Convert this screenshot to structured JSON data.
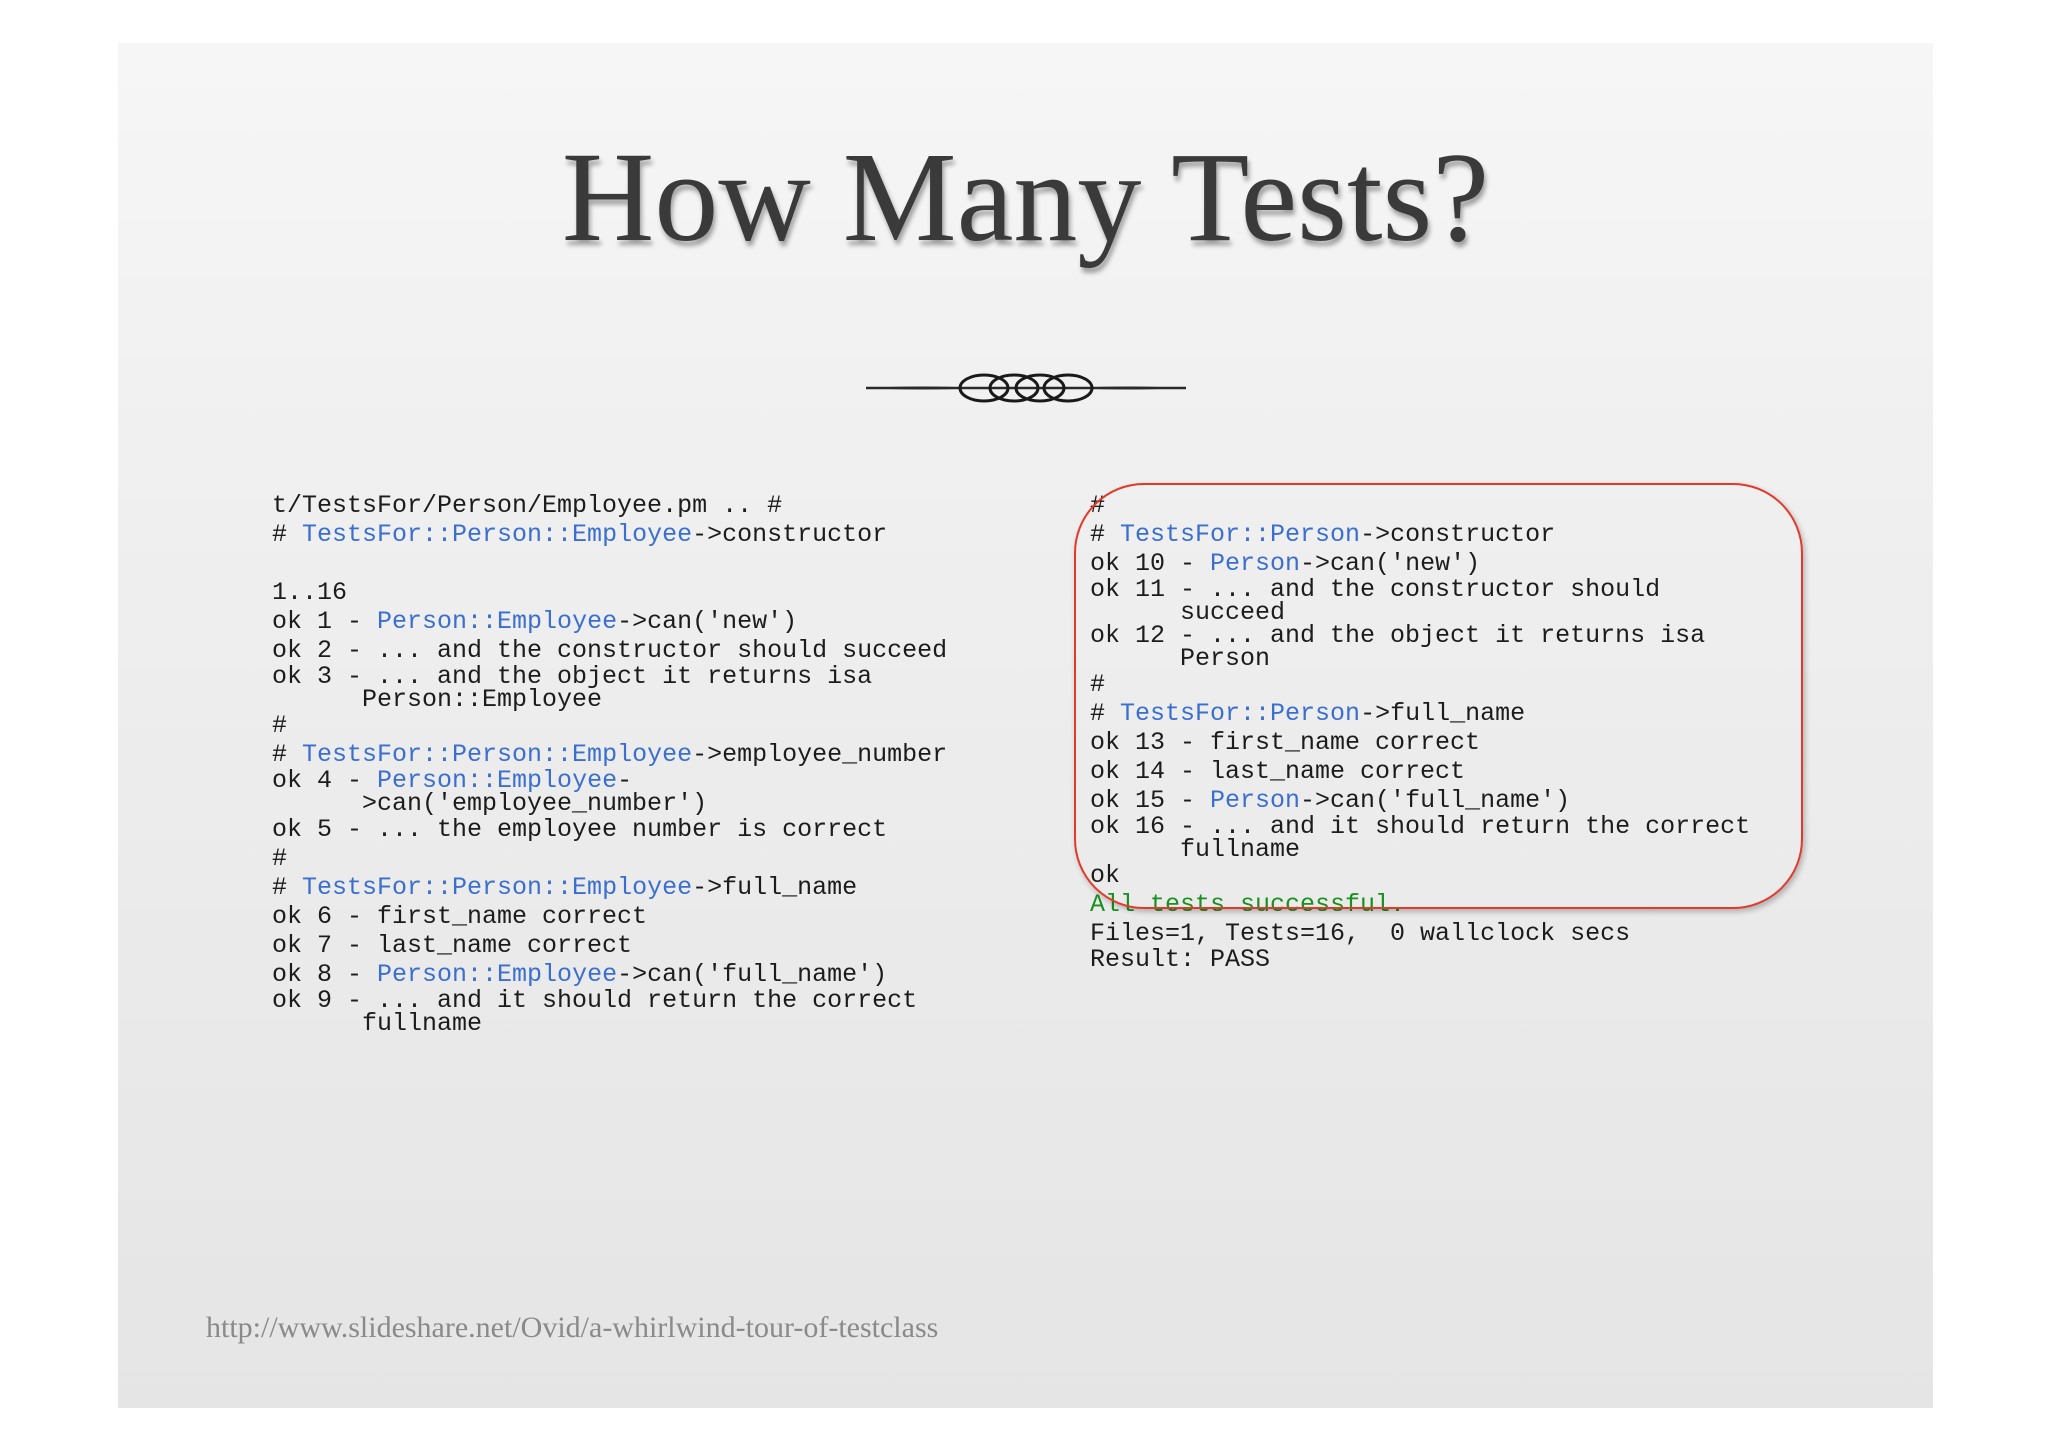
{
  "slide": {
    "title": "How Many Tests?",
    "footer_url": "http://www.slideshare.net/Ovid/a-whirlwind-tour-of-testclass"
  },
  "left": {
    "l1": "t/TestsFor/Person/Employee.pm .. #",
    "l2_hash": "# ",
    "l2_cls": "TestsFor::Person::Employee",
    "l2_rest": "->constructor",
    "l3": "1..16",
    "l4_pre": "ok 1 - ",
    "l4_cls": "Person::Employee",
    "l4_rest": "->can('new')",
    "l5": "ok 2 - ... and the constructor should succeed",
    "l6": "ok 3 - ... and the object it returns isa",
    "l6b": "      Person::Employee",
    "l7": "#",
    "l8_hash": "# ",
    "l8_cls": "TestsFor::Person::Employee",
    "l8_rest": "->employee_number",
    "l9_pre": "ok 4 - ",
    "l9_cls": "Person::Employee",
    "l9_rest": "-",
    "l9b": "      >can('employee_number')",
    "l10": "ok 5 - ... the employee number is correct",
    "l11": "#",
    "l12_hash": "# ",
    "l12_cls": "TestsFor::Person::Employee",
    "l12_rest": "->full_name",
    "l13": "ok 6 - first_name correct",
    "l14": "ok 7 - last_name correct",
    "l15_pre": "ok 8 - ",
    "l15_cls": "Person::Employee",
    "l15_rest": "->can('full_name')",
    "l16": "ok 9 - ... and it should return the correct",
    "l16b": "      fullname"
  },
  "right": {
    "r1": "#",
    "r2_hash": "# ",
    "r2_cls": "TestsFor::Person",
    "r2_rest": "->constructor",
    "r3_pre": "ok 10 - ",
    "r3_cls": "Person",
    "r3_rest": "->can('new')",
    "r4": "ok 11 - ... and the constructor should",
    "r4b": "      succeed",
    "r5": "ok 12 - ... and the object it returns isa",
    "r5b": "      Person",
    "r6": "#",
    "r7_hash": "# ",
    "r7_cls": "TestsFor::Person",
    "r7_rest": "->full_name",
    "r8": "ok 13 - first_name correct",
    "r9": "ok 14 - last_name correct",
    "r10_pre": "ok 15 - ",
    "r10_cls": "Person",
    "r10_rest": "->can('full_name')",
    "r11": "ok 16 - ... and it should return the correct",
    "r11b": "      fullname",
    "r12": "ok",
    "r13": "All tests successful.",
    "r14": "Files=1, Tests=16,  0 wallclock secs",
    "r15": "Result: PASS"
  },
  "colors": {
    "class_name": "#3a6fd0",
    "success": "#17921f",
    "highlight": "#e23a2a"
  }
}
